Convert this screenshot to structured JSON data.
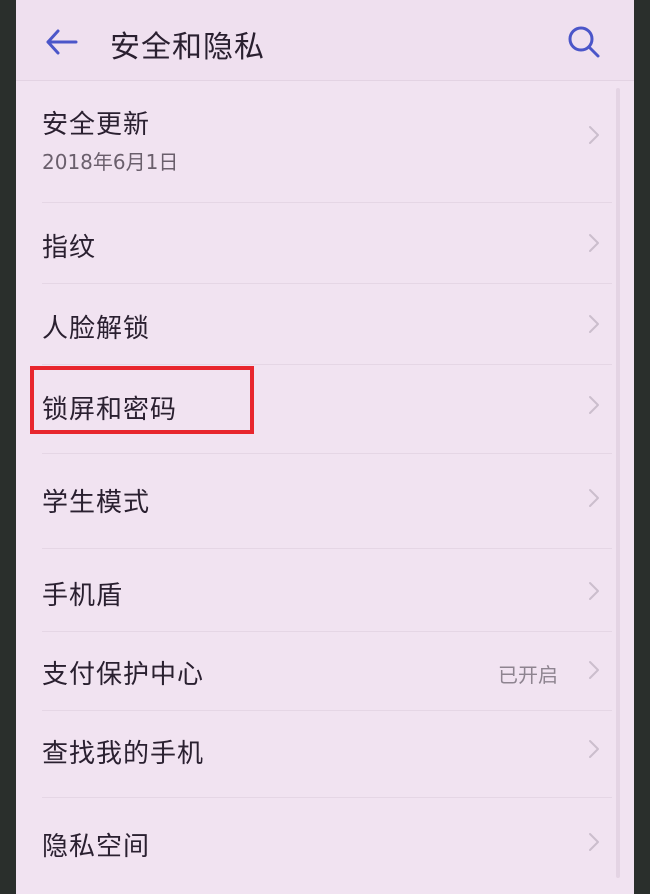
{
  "header": {
    "title": "安全和隐私"
  },
  "items": [
    {
      "label": "安全更新",
      "subtitle": "2018年6月1日"
    },
    {
      "label": "指纹"
    },
    {
      "label": "人脸解锁"
    },
    {
      "label": "锁屏和密码"
    },
    {
      "label": "学生模式"
    },
    {
      "label": "手机盾"
    },
    {
      "label": "支付保护中心",
      "value": "已开启"
    },
    {
      "label": "查找我的手机"
    },
    {
      "label": "隐私空间"
    }
  ],
  "colors": {
    "background": "#f1e3f1",
    "accent": "#4b56c9",
    "highlight_box": "#e8262e"
  },
  "icons": {
    "back": "back-arrow-icon",
    "search": "search-icon",
    "chevron": "chevron-right-icon"
  }
}
